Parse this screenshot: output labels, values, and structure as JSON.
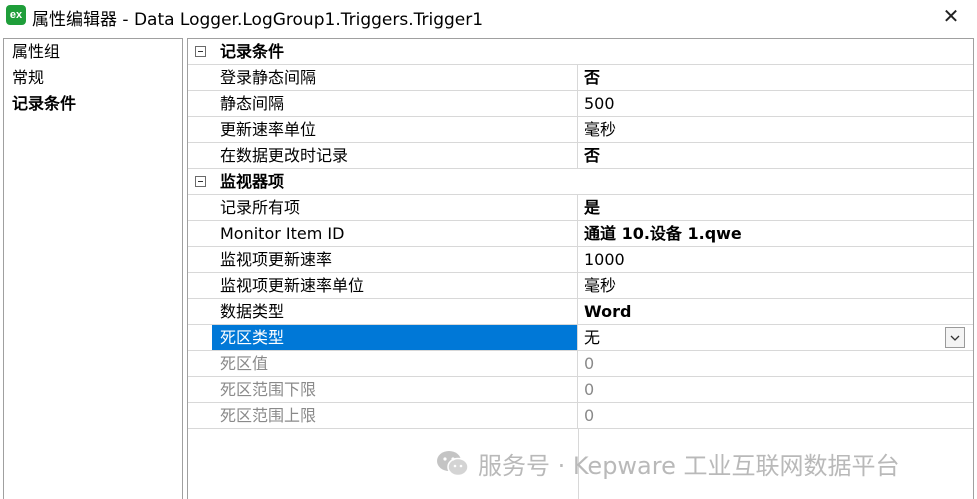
{
  "window": {
    "app_icon_text": "ex",
    "title": "属性编辑器 - Data Logger.LogGroup1.Triggers.Trigger1",
    "close_glyph": "✕"
  },
  "nav": {
    "items": [
      {
        "label": "属性组",
        "active": false
      },
      {
        "label": "常规",
        "active": false
      },
      {
        "label": "记录条件",
        "active": true
      }
    ]
  },
  "grid": {
    "categories": [
      {
        "label": "记录条件",
        "rows": [
          {
            "name": "登录静态间隔",
            "value": "否",
            "value_bold": true
          },
          {
            "name": "静态间隔",
            "value": "500",
            "value_bold": false
          },
          {
            "name": "更新速率单位",
            "value": "毫秒",
            "value_bold": false
          },
          {
            "name": "在数据更改时记录",
            "value": "否",
            "value_bold": true
          }
        ]
      },
      {
        "label": "监视器项",
        "rows": [
          {
            "name": "记录所有项",
            "value": "是",
            "value_bold": true
          },
          {
            "name": "Monitor Item ID",
            "value": "通道 10.设备 1.qwe",
            "value_bold": true
          },
          {
            "name": "监视项更新速率",
            "value": "1000",
            "value_bold": false
          },
          {
            "name": "监视项更新速率单位",
            "value": "毫秒",
            "value_bold": false
          },
          {
            "name": "数据类型",
            "value": "Word",
            "value_bold": true
          },
          {
            "name": "死区类型",
            "value": "无",
            "value_bold": false,
            "selected": true,
            "dropdown": true
          },
          {
            "name": "死区值",
            "value": "0",
            "disabled": true
          },
          {
            "name": "死区范围下限",
            "value": "0",
            "disabled": true
          },
          {
            "name": "死区范围上限",
            "value": "0",
            "disabled": true
          }
        ]
      }
    ]
  },
  "watermark": {
    "text": "服务号 · Kepware 工业互联网数据平台",
    "icon": "wechat-icon"
  },
  "colors": {
    "selection": "#0078d7",
    "grid_line": "#d8d8d8",
    "disabled_text": "#8a8a8a",
    "app_icon": "#1f9e3a"
  }
}
